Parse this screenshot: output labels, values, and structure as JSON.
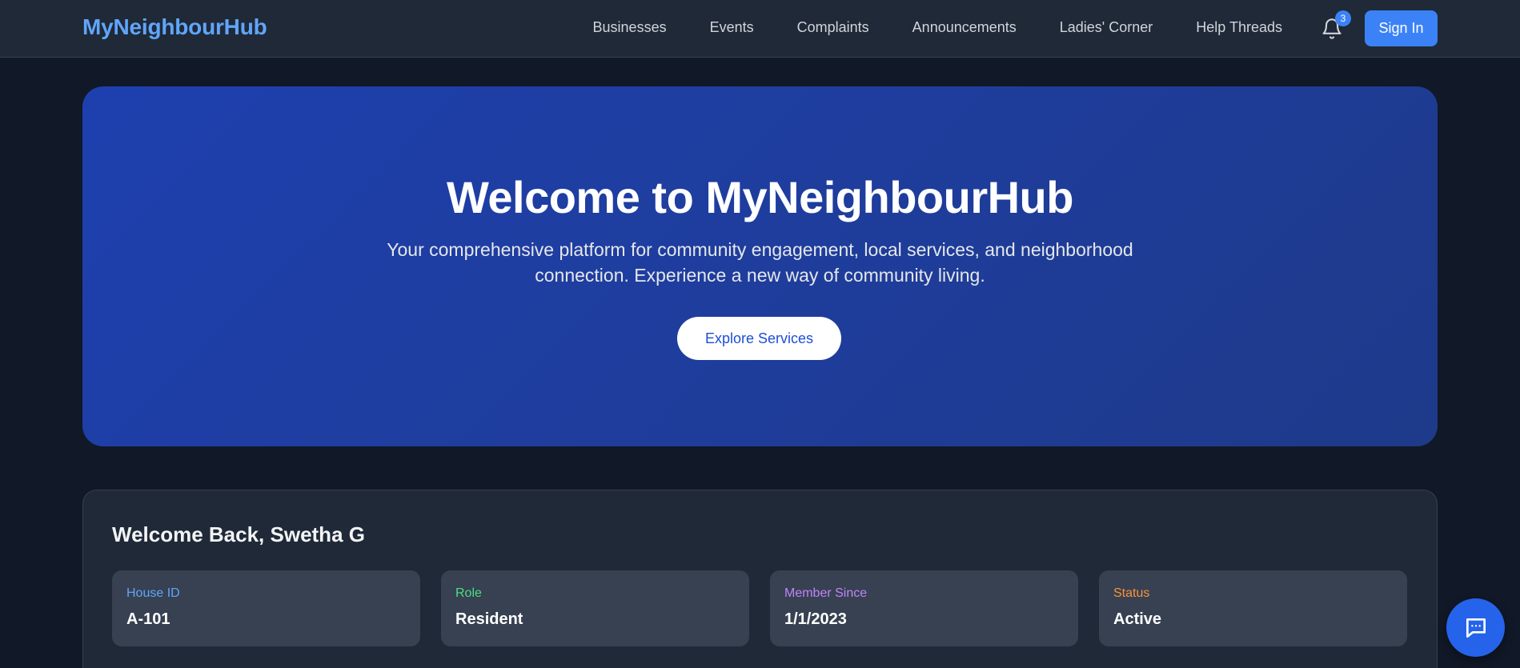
{
  "header": {
    "brand": "MyNeighbourHub",
    "nav": [
      {
        "label": "Businesses"
      },
      {
        "label": "Events"
      },
      {
        "label": "Complaints"
      },
      {
        "label": "Announcements"
      },
      {
        "label": "Ladies' Corner"
      },
      {
        "label": "Help Threads"
      }
    ],
    "notification_count": "3",
    "sign_in_label": "Sign In",
    "icons": {
      "notifications": "bell-icon"
    }
  },
  "hero": {
    "title": "Welcome to MyNeighbourHub",
    "subtitle": "Your comprehensive platform for community engagement, local services, and neighborhood connection. Experience a new way of community living.",
    "cta_label": "Explore Services"
  },
  "welcome": {
    "title": "Welcome Back, Swetha G",
    "stats": [
      {
        "label": "House ID",
        "value": "A-101",
        "color": "#60a5fa"
      },
      {
        "label": "Role",
        "value": "Resident",
        "color": "#4ade80"
      },
      {
        "label": "Member Since",
        "value": "1/1/2023",
        "color": "#c084fc"
      },
      {
        "label": "Status",
        "value": "Active",
        "color": "#fb923c"
      }
    ]
  },
  "chat": {
    "icon": "chat-icon"
  },
  "colors": {
    "background": "#111827",
    "navbar": "#1f2937",
    "accent": "#3b82f6",
    "hero": "#1e40af"
  }
}
